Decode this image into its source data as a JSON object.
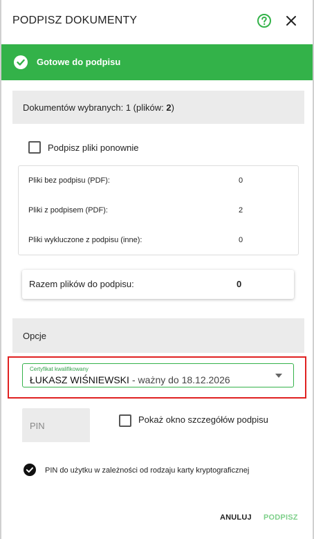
{
  "dialog": {
    "title": "PODPISZ DOKUMENTY",
    "help_icon": "help-circle-icon",
    "close_icon": "close-icon"
  },
  "status": {
    "text": "Gotowe do podpisu",
    "icon": "check-circle-icon",
    "color": "#33b249"
  },
  "selection": {
    "prefix": "Dokumentów wybranych: 1 (plików: ",
    "files_count": "2",
    "suffix": ")"
  },
  "resign": {
    "label": "Podpisz pliki ponownie",
    "checked": false
  },
  "files": [
    {
      "label": "Pliki bez podpisu (PDF):",
      "value": "0"
    },
    {
      "label": "Pliki z podpisem (PDF):",
      "value": "2"
    },
    {
      "label": "Pliki wykluczone z podpisu (inne):",
      "value": "0"
    }
  ],
  "total": {
    "label": "Razem plików do podpisu:",
    "value": "0"
  },
  "options": {
    "title": "Opcje"
  },
  "certificate": {
    "label": "Certyfikat kwalifikowany",
    "name": "ŁUKASZ WIŚNIEWSKI",
    "valid": "- ważny do 18.12.2026"
  },
  "pin": {
    "placeholder": "PIN"
  },
  "details": {
    "label": "Pokaż okno szczegółów podpisu",
    "checked": false
  },
  "note": {
    "text": "PIN do użytku w zależności od rodzaju karty kryptograficznej",
    "icon": "check-circle-filled-icon"
  },
  "actions": {
    "cancel": "ANULUJ",
    "sign": "PODPISZ"
  },
  "colors": {
    "accent": "#33b249",
    "highlight": "#e02020",
    "disabled_accent": "#7ed08a"
  }
}
